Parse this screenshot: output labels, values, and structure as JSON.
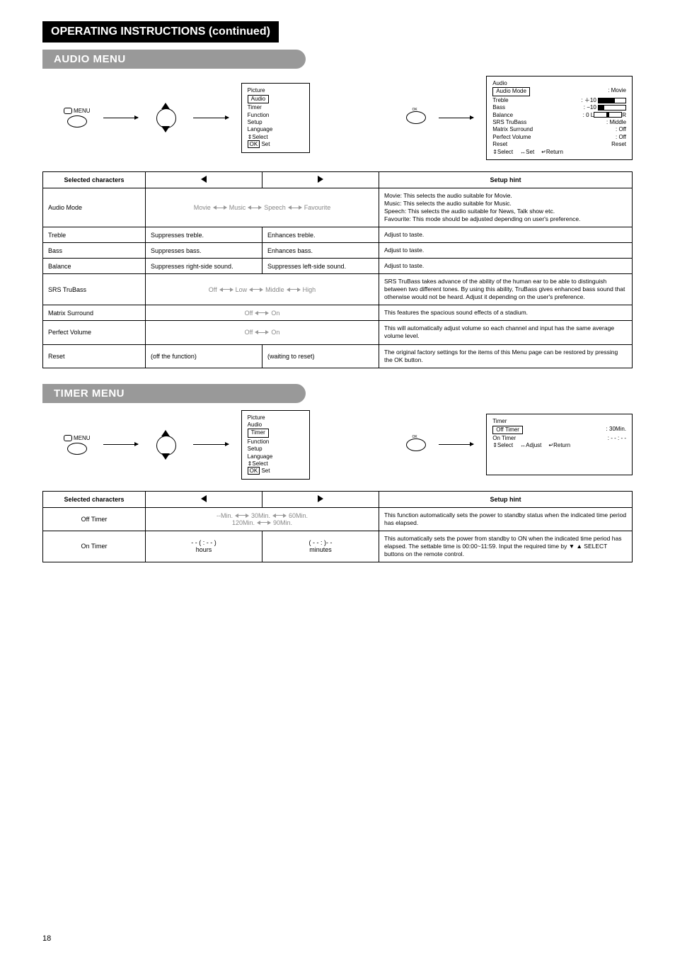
{
  "title_bar": "OPERATING INSTRUCTIONS (continued)",
  "audio_section": "AUDIO MENU",
  "timer_section": "TIMER MENU",
  "menu_label": "MENU",
  "main_menu": {
    "items": [
      "Picture",
      "Audio",
      "Timer",
      "Function",
      "Setup",
      "Language"
    ],
    "footer1": "Select",
    "footer2_ok": "OK",
    "footer2_set": "Set"
  },
  "audio_panel": {
    "title": "Audio",
    "rows": [
      {
        "l": "Audio Mode",
        "r": ": Movie"
      },
      {
        "l": "Treble",
        "r": ": ＋10"
      },
      {
        "l": "Bass",
        "r": ": −10"
      },
      {
        "l": "Balance",
        "r": ":     0"
      },
      {
        "l": "SRS TruBass",
        "r": ": Middle"
      },
      {
        "l": "Matrix Surround",
        "r": ": Off"
      },
      {
        "l": "Perfect Volume",
        "r": ": Off"
      },
      {
        "l": "Reset",
        "r": "  Reset"
      }
    ],
    "footer_select": "Select",
    "footer_set": "Set",
    "footer_return": "Return",
    "balance_L": "L",
    "balance_R": "R"
  },
  "timer_panel": {
    "title": "Timer",
    "rows": [
      {
        "l": "Off Timer",
        "r": ":    30Min."
      },
      {
        "l": "On Timer",
        "r": ":   - - : - -"
      }
    ],
    "footer_select": "Select",
    "footer_adjust": "Adjust",
    "footer_return": "Return"
  },
  "table_headers": {
    "selchar": "Selected characters",
    "hint": "Setup hint"
  },
  "audio_table": [
    {
      "name": "Audio Mode",
      "span": "Movie      Music      Speech      Favourite",
      "hint": "Movie: This selects the audio suitable for Movie.\nMusic: This selects the audio suitable for Music.\nSpeech: This selects the audio suitable for News, Talk show etc.\nFavourite: This mode should be adjusted depending on user's preference."
    },
    {
      "name": "Treble",
      "left": "Suppresses treble.",
      "right": "Enhances treble.",
      "hint": "Adjust to taste."
    },
    {
      "name": "Bass",
      "left": "Suppresses bass.",
      "right": "Enhances bass.",
      "hint": "Adjust to taste."
    },
    {
      "name": "Balance",
      "left": "Suppresses right-side sound.",
      "right": "Suppresses left-side sound.",
      "hint": "Adjust to taste."
    },
    {
      "name": "SRS TruBass",
      "span": "Off      Low      Middle      High",
      "hint": "SRS TruBass takes advance of the ability of the human ear to be able to distinguish between two different tones. By using this ability, TruBass gives enhanced bass sound that otherwise would not be heard. Adjust it depending on the user's preference."
    },
    {
      "name": "Matrix Surround",
      "span": "Off        On",
      "hint": "This features the spacious sound effects of a stadium."
    },
    {
      "name": "Perfect Volume",
      "span": "Off        On",
      "hint": "This will automatically adjust volume so each channel and input has the same average volume level."
    },
    {
      "name": "Reset",
      "left": "(off the function)",
      "right": "(waiting to reset)",
      "hint": "The original factory settings for the items of this Menu page can be restored by pressing the OK button."
    }
  ],
  "timer_table": [
    {
      "name": "Off Timer",
      "span": "--Min.      30Min.      60Min.\n120Min.      90Min.",
      "hint": "This function automatically sets the power to standby status when the indicated time period has elapsed."
    },
    {
      "name": "On Timer",
      "left": "- - ( : - - )\nhours",
      "right": "( - -  : )- -\nminutes",
      "hint": "This automatically sets the power from standby to ON when the indicated time period has elapsed. The settable time is 00:00~11:59. Input the required time by ▼ ▲ SELECT buttons on the remote control."
    }
  ],
  "page_number": "18"
}
